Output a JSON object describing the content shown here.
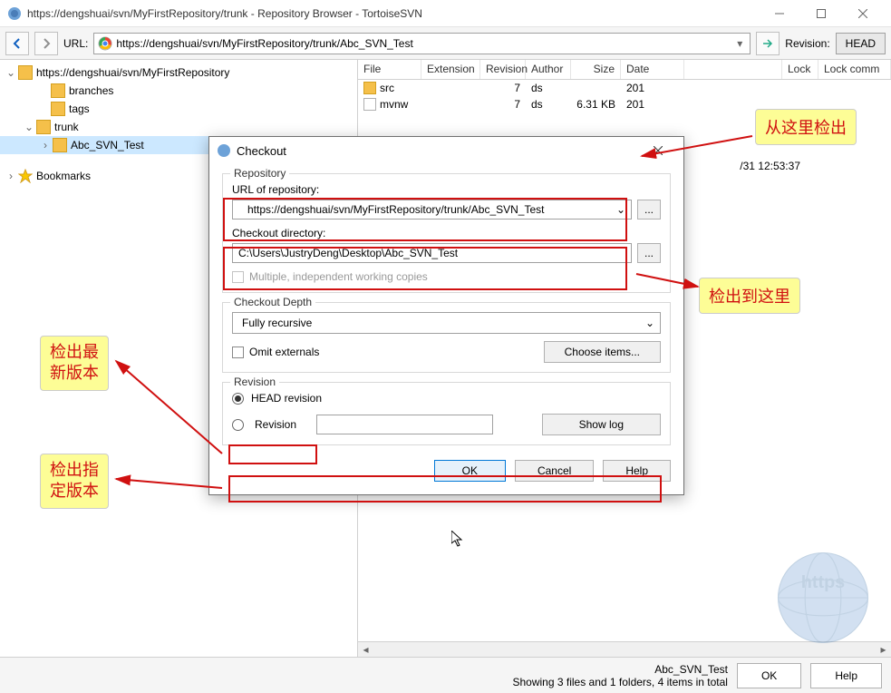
{
  "window": {
    "title": "https://dengshuai/svn/MyFirstRepository/trunk - Repository Browser - TortoiseSVN"
  },
  "toolbar": {
    "url_label": "URL:",
    "url_value": "https://dengshuai/svn/MyFirstRepository/trunk/Abc_SVN_Test",
    "rev_label": "Revision:",
    "rev_btn": "HEAD"
  },
  "tree": {
    "root": "https://dengshuai/svn/MyFirstRepository",
    "nodes": [
      {
        "label": "branches",
        "indent": 2
      },
      {
        "label": "tags",
        "indent": 2
      },
      {
        "label": "trunk",
        "indent": 2,
        "expanded": true
      },
      {
        "label": "Abc_SVN_Test",
        "indent": 3,
        "selected": true
      }
    ],
    "bookmarks": "Bookmarks"
  },
  "list": {
    "headers": [
      "File",
      "Extension",
      "Revision",
      "Author",
      "Size",
      "Date",
      "Lock",
      "Lock comm"
    ],
    "rows": [
      {
        "file": "src",
        "ext": "",
        "rev": "7",
        "author": "ds",
        "size": "",
        "date": "201",
        "folder": true
      },
      {
        "file": "mvnw",
        "ext": "",
        "rev": "7",
        "author": "ds",
        "size": "6.31 KB",
        "date": "201",
        "folder": false
      }
    ],
    "partial_date": "/31 12:53:37"
  },
  "dialog": {
    "title": "Checkout",
    "repo_group": "Repository",
    "url_label": "URL of repository:",
    "url_value": "https://dengshuai/svn/MyFirstRepository/trunk/Abc_SVN_Test",
    "dir_label": "Checkout directory:",
    "dir_value": "C:\\Users\\JustryDeng\\Desktop\\Abc_SVN_Test",
    "multi_cb": "Multiple, independent working copies",
    "depth_group": "Checkout Depth",
    "depth_value": "Fully recursive",
    "omit_cb": "Omit externals",
    "choose_btn": "Choose items...",
    "rev_group": "Revision",
    "head_radio": "HEAD revision",
    "rev_radio": "Revision",
    "showlog_btn": "Show log",
    "ok": "OK",
    "cancel": "Cancel",
    "help": "Help"
  },
  "annotations": {
    "a1": "从这里检出",
    "a2": "检出到这里",
    "a3_l1": "检出最",
    "a3_l2": "新版本",
    "a4_l1": "检出指",
    "a4_l2": "定版本"
  },
  "status": {
    "line1": "Abc_SVN_Test",
    "line2": "Showing 3 files and 1 folders, 4 items in total",
    "ok": "OK",
    "help": "Help"
  },
  "watermark": "https"
}
